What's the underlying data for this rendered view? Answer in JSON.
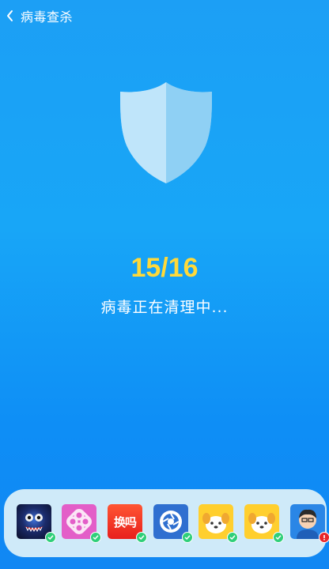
{
  "header": {
    "title": "病毒查杀",
    "back_icon": "chevron-left-icon"
  },
  "scan": {
    "counter": "15/16",
    "status": "病毒正在清理中...",
    "progress_fraction": 0.9375
  },
  "tray": {
    "apps": [
      {
        "icon": "dark-monster-app-icon",
        "status": "safe"
      },
      {
        "icon": "pink-knot-app-icon",
        "status": "safe"
      },
      {
        "icon": "huanma-app-icon",
        "label": "换吗",
        "status": "safe"
      },
      {
        "icon": "shutter-app-icon",
        "status": "safe"
      },
      {
        "icon": "yellow-dog-app-icon",
        "status": "safe"
      },
      {
        "icon": "yellow-dog-app-icon",
        "status": "safe"
      },
      {
        "icon": "avatar-app-icon",
        "status": "warning"
      }
    ]
  },
  "colors": {
    "background_top": "#1c9ff5",
    "background_bottom": "#1187f3",
    "counter": "#ffd93a",
    "tray": "#cfeaf9",
    "safe_badge": "#2fcf7a",
    "warn_badge": "#e8262a"
  }
}
